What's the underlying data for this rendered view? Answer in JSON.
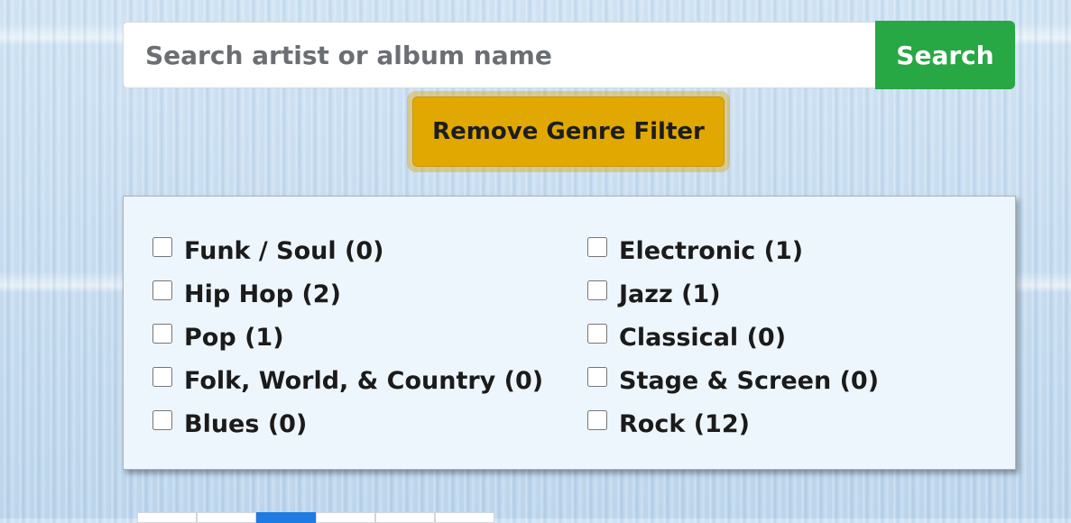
{
  "search": {
    "placeholder": "Search artist or album name",
    "value": "",
    "button_label": "Search"
  },
  "filter": {
    "remove_label": "Remove Genre Filter"
  },
  "genres": {
    "left": [
      {
        "label": "Funk / Soul (0)",
        "checked": false
      },
      {
        "label": "Hip Hop (2)",
        "checked": false
      },
      {
        "label": "Pop (1)",
        "checked": false
      },
      {
        "label": "Folk, World, & Country (0)",
        "checked": false
      },
      {
        "label": "Blues (0)",
        "checked": false
      }
    ],
    "right": [
      {
        "label": "Electronic (1)",
        "checked": false
      },
      {
        "label": "Jazz (1)",
        "checked": false
      },
      {
        "label": "Classical (0)",
        "checked": false
      },
      {
        "label": "Stage & Screen (0)",
        "checked": false
      },
      {
        "label": "Rock (12)",
        "checked": false
      }
    ]
  },
  "pagination": {
    "active_index": 2
  },
  "colors": {
    "search_button": "#28a745",
    "remove_filter_button": "#e0a800",
    "panel_background": "#eef6fd",
    "pagination_active": "#1e7be0"
  }
}
